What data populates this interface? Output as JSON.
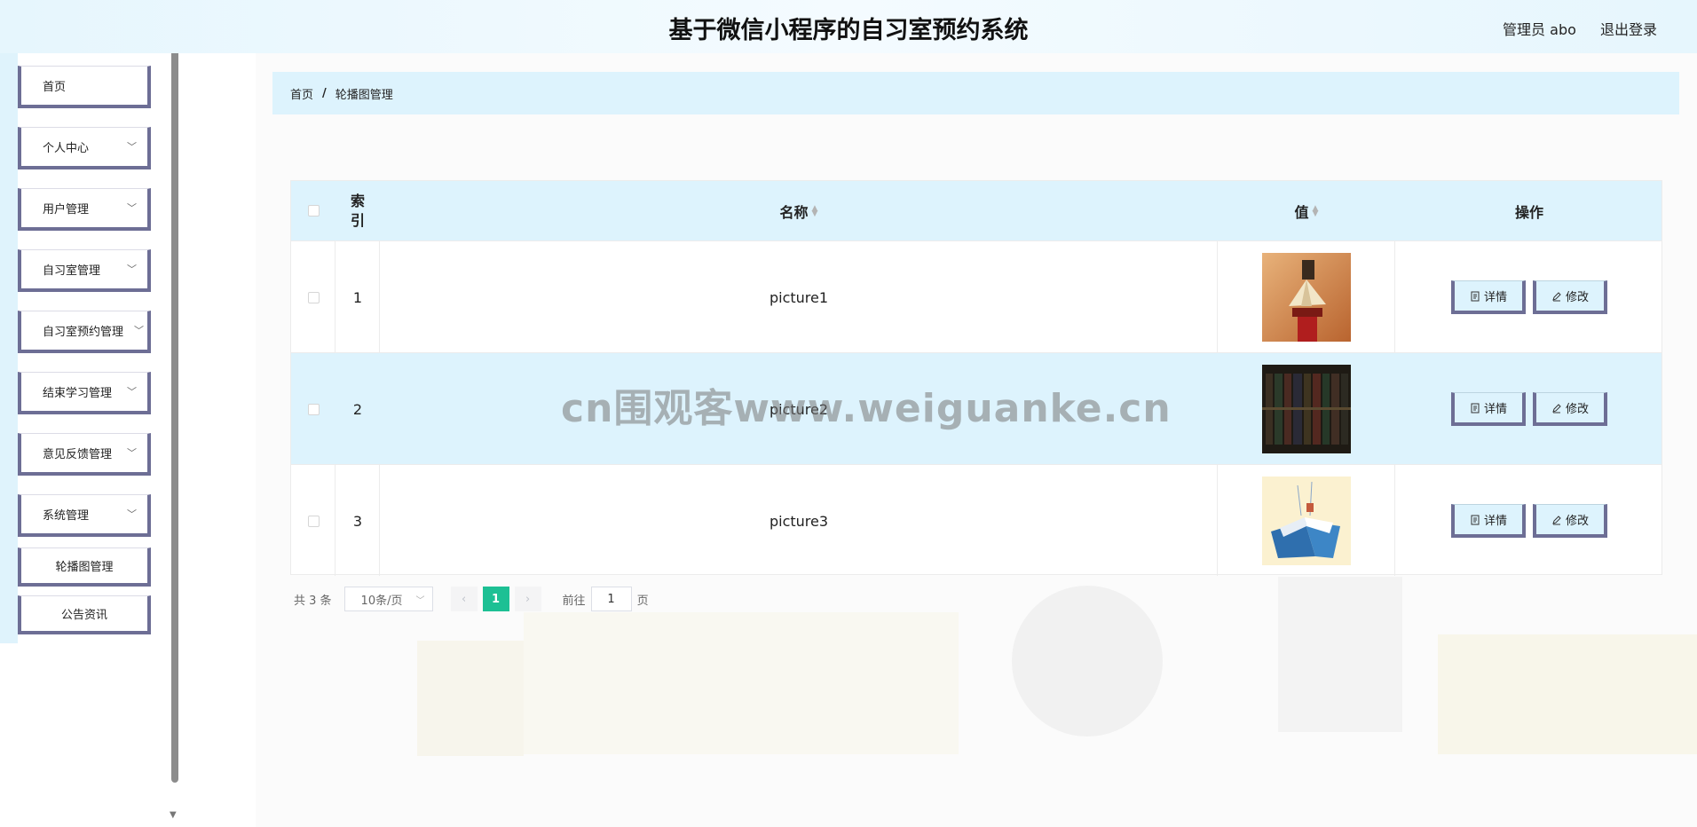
{
  "header": {
    "title": "基于微信小程序的自习室预约系统",
    "user": "管理员 abo",
    "logout": "退出登录"
  },
  "sidebar": {
    "items": [
      {
        "label": "首页",
        "has_children": false
      },
      {
        "label": "个人中心",
        "has_children": true
      },
      {
        "label": "用户管理",
        "has_children": true
      },
      {
        "label": "自习室管理",
        "has_children": true
      },
      {
        "label": "自习室预约管理",
        "has_children": true
      },
      {
        "label": "结束学习管理",
        "has_children": true
      },
      {
        "label": "意见反馈管理",
        "has_children": true
      },
      {
        "label": "系统管理",
        "has_children": true
      }
    ],
    "sub_items": [
      {
        "label": "轮播图管理"
      },
      {
        "label": "公告资讯"
      }
    ]
  },
  "breadcrumb": {
    "home": "首页",
    "separator": "/",
    "current": "轮播图管理"
  },
  "table": {
    "columns": {
      "index": "索引",
      "name": "名称",
      "value": "值",
      "actions": "操作"
    },
    "rows": [
      {
        "index": "1",
        "name": "picture1",
        "value_image": "book-on-pedestal"
      },
      {
        "index": "2",
        "name": "picture2",
        "value_image": "bookshelf-dark"
      },
      {
        "index": "3",
        "name": "picture3",
        "value_image": "open-book-illustration"
      }
    ],
    "detail_label": "详情",
    "edit_label": "修改"
  },
  "pagination": {
    "total": "共 3 条",
    "page_size": "10条/页",
    "current_page": "1",
    "goto_prefix": "前往",
    "goto_value": "1",
    "goto_suffix": "页"
  },
  "watermark": "cn围观客www.weiguanke.cn",
  "colors": {
    "accent_light": "#ddf3fd",
    "menu_border": "#6d6e95",
    "pager_active": "#1dc094"
  }
}
